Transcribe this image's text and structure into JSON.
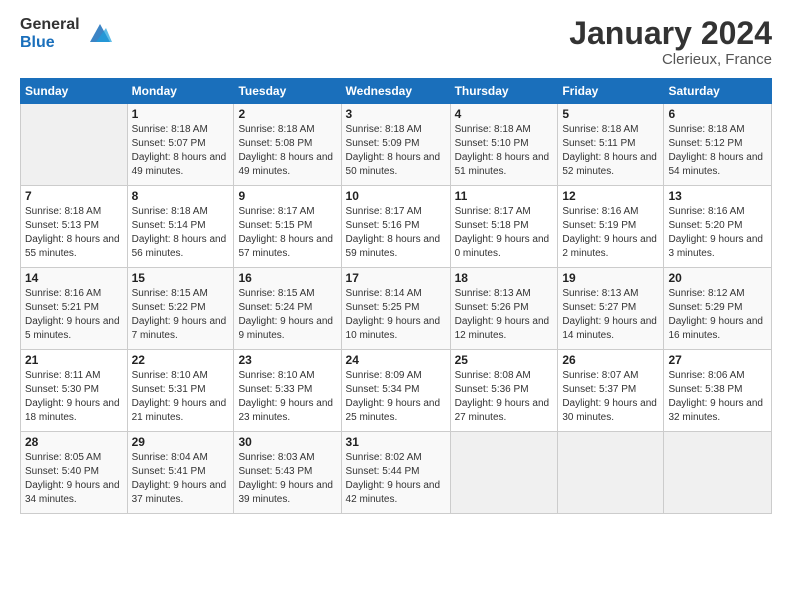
{
  "header": {
    "logo_general": "General",
    "logo_blue": "Blue",
    "month_title": "January 2024",
    "location": "Clerieux, France"
  },
  "days_of_week": [
    "Sunday",
    "Monday",
    "Tuesday",
    "Wednesday",
    "Thursday",
    "Friday",
    "Saturday"
  ],
  "weeks": [
    [
      {
        "day": "",
        "sunrise": "",
        "sunset": "",
        "daylight": ""
      },
      {
        "day": "1",
        "sunrise": "Sunrise: 8:18 AM",
        "sunset": "Sunset: 5:07 PM",
        "daylight": "Daylight: 8 hours and 49 minutes."
      },
      {
        "day": "2",
        "sunrise": "Sunrise: 8:18 AM",
        "sunset": "Sunset: 5:08 PM",
        "daylight": "Daylight: 8 hours and 49 minutes."
      },
      {
        "day": "3",
        "sunrise": "Sunrise: 8:18 AM",
        "sunset": "Sunset: 5:09 PM",
        "daylight": "Daylight: 8 hours and 50 minutes."
      },
      {
        "day": "4",
        "sunrise": "Sunrise: 8:18 AM",
        "sunset": "Sunset: 5:10 PM",
        "daylight": "Daylight: 8 hours and 51 minutes."
      },
      {
        "day": "5",
        "sunrise": "Sunrise: 8:18 AM",
        "sunset": "Sunset: 5:11 PM",
        "daylight": "Daylight: 8 hours and 52 minutes."
      },
      {
        "day": "6",
        "sunrise": "Sunrise: 8:18 AM",
        "sunset": "Sunset: 5:12 PM",
        "daylight": "Daylight: 8 hours and 54 minutes."
      }
    ],
    [
      {
        "day": "7",
        "sunrise": "Sunrise: 8:18 AM",
        "sunset": "Sunset: 5:13 PM",
        "daylight": "Daylight: 8 hours and 55 minutes."
      },
      {
        "day": "8",
        "sunrise": "Sunrise: 8:18 AM",
        "sunset": "Sunset: 5:14 PM",
        "daylight": "Daylight: 8 hours and 56 minutes."
      },
      {
        "day": "9",
        "sunrise": "Sunrise: 8:17 AM",
        "sunset": "Sunset: 5:15 PM",
        "daylight": "Daylight: 8 hours and 57 minutes."
      },
      {
        "day": "10",
        "sunrise": "Sunrise: 8:17 AM",
        "sunset": "Sunset: 5:16 PM",
        "daylight": "Daylight: 8 hours and 59 minutes."
      },
      {
        "day": "11",
        "sunrise": "Sunrise: 8:17 AM",
        "sunset": "Sunset: 5:18 PM",
        "daylight": "Daylight: 9 hours and 0 minutes."
      },
      {
        "day": "12",
        "sunrise": "Sunrise: 8:16 AM",
        "sunset": "Sunset: 5:19 PM",
        "daylight": "Daylight: 9 hours and 2 minutes."
      },
      {
        "day": "13",
        "sunrise": "Sunrise: 8:16 AM",
        "sunset": "Sunset: 5:20 PM",
        "daylight": "Daylight: 9 hours and 3 minutes."
      }
    ],
    [
      {
        "day": "14",
        "sunrise": "Sunrise: 8:16 AM",
        "sunset": "Sunset: 5:21 PM",
        "daylight": "Daylight: 9 hours and 5 minutes."
      },
      {
        "day": "15",
        "sunrise": "Sunrise: 8:15 AM",
        "sunset": "Sunset: 5:22 PM",
        "daylight": "Daylight: 9 hours and 7 minutes."
      },
      {
        "day": "16",
        "sunrise": "Sunrise: 8:15 AM",
        "sunset": "Sunset: 5:24 PM",
        "daylight": "Daylight: 9 hours and 9 minutes."
      },
      {
        "day": "17",
        "sunrise": "Sunrise: 8:14 AM",
        "sunset": "Sunset: 5:25 PM",
        "daylight": "Daylight: 9 hours and 10 minutes."
      },
      {
        "day": "18",
        "sunrise": "Sunrise: 8:13 AM",
        "sunset": "Sunset: 5:26 PM",
        "daylight": "Daylight: 9 hours and 12 minutes."
      },
      {
        "day": "19",
        "sunrise": "Sunrise: 8:13 AM",
        "sunset": "Sunset: 5:27 PM",
        "daylight": "Daylight: 9 hours and 14 minutes."
      },
      {
        "day": "20",
        "sunrise": "Sunrise: 8:12 AM",
        "sunset": "Sunset: 5:29 PM",
        "daylight": "Daylight: 9 hours and 16 minutes."
      }
    ],
    [
      {
        "day": "21",
        "sunrise": "Sunrise: 8:11 AM",
        "sunset": "Sunset: 5:30 PM",
        "daylight": "Daylight: 9 hours and 18 minutes."
      },
      {
        "day": "22",
        "sunrise": "Sunrise: 8:10 AM",
        "sunset": "Sunset: 5:31 PM",
        "daylight": "Daylight: 9 hours and 21 minutes."
      },
      {
        "day": "23",
        "sunrise": "Sunrise: 8:10 AM",
        "sunset": "Sunset: 5:33 PM",
        "daylight": "Daylight: 9 hours and 23 minutes."
      },
      {
        "day": "24",
        "sunrise": "Sunrise: 8:09 AM",
        "sunset": "Sunset: 5:34 PM",
        "daylight": "Daylight: 9 hours and 25 minutes."
      },
      {
        "day": "25",
        "sunrise": "Sunrise: 8:08 AM",
        "sunset": "Sunset: 5:36 PM",
        "daylight": "Daylight: 9 hours and 27 minutes."
      },
      {
        "day": "26",
        "sunrise": "Sunrise: 8:07 AM",
        "sunset": "Sunset: 5:37 PM",
        "daylight": "Daylight: 9 hours and 30 minutes."
      },
      {
        "day": "27",
        "sunrise": "Sunrise: 8:06 AM",
        "sunset": "Sunset: 5:38 PM",
        "daylight": "Daylight: 9 hours and 32 minutes."
      }
    ],
    [
      {
        "day": "28",
        "sunrise": "Sunrise: 8:05 AM",
        "sunset": "Sunset: 5:40 PM",
        "daylight": "Daylight: 9 hours and 34 minutes."
      },
      {
        "day": "29",
        "sunrise": "Sunrise: 8:04 AM",
        "sunset": "Sunset: 5:41 PM",
        "daylight": "Daylight: 9 hours and 37 minutes."
      },
      {
        "day": "30",
        "sunrise": "Sunrise: 8:03 AM",
        "sunset": "Sunset: 5:43 PM",
        "daylight": "Daylight: 9 hours and 39 minutes."
      },
      {
        "day": "31",
        "sunrise": "Sunrise: 8:02 AM",
        "sunset": "Sunset: 5:44 PM",
        "daylight": "Daylight: 9 hours and 42 minutes."
      },
      {
        "day": "",
        "sunrise": "",
        "sunset": "",
        "daylight": ""
      },
      {
        "day": "",
        "sunrise": "",
        "sunset": "",
        "daylight": ""
      },
      {
        "day": "",
        "sunrise": "",
        "sunset": "",
        "daylight": ""
      }
    ]
  ]
}
